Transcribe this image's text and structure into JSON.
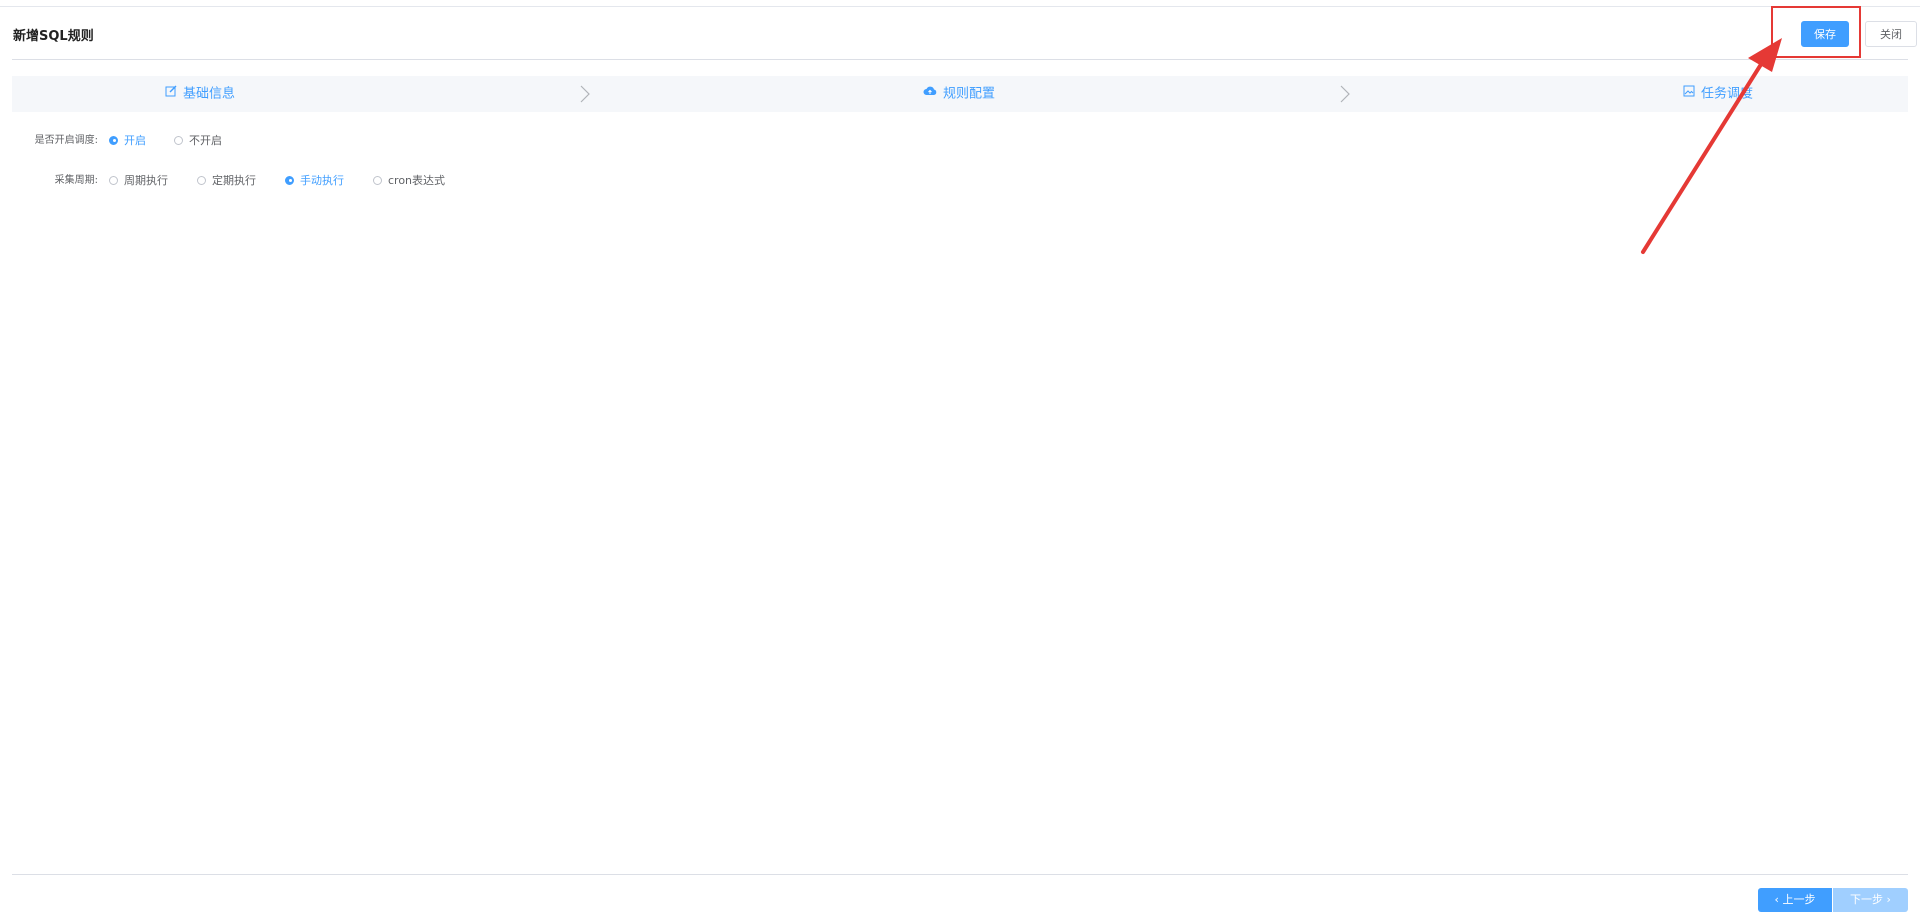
{
  "header": {
    "title": "新增SQL规则",
    "save_label": "保存",
    "close_label": "关闭"
  },
  "steps": [
    {
      "label": "基础信息",
      "icon": "edit-icon"
    },
    {
      "label": "规则配置",
      "icon": "cloud-upload-icon"
    },
    {
      "label": "任务调度",
      "icon": "picture-icon"
    }
  ],
  "form": {
    "schedule_enabled": {
      "label": "是否开启调度:",
      "options": [
        "开启",
        "不开启"
      ],
      "selected": "开启"
    },
    "collect_cycle": {
      "label": "采集周期:",
      "options": [
        "周期执行",
        "定期执行",
        "手动执行",
        "cron表达式"
      ],
      "selected": "手动执行"
    }
  },
  "footer": {
    "prev_label": "上一步",
    "next_label": "下一步"
  },
  "colors": {
    "primary": "#409eff",
    "primary_disabled": "#a0cfff",
    "annotation_red": "#e53935"
  }
}
